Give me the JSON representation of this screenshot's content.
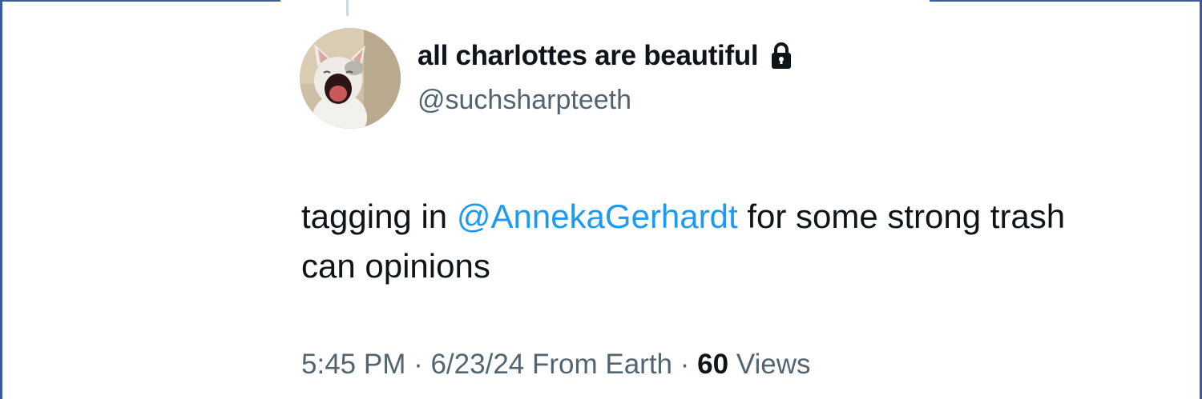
{
  "author": {
    "display_name": "all charlottes are beautiful",
    "handle": "@suchsharpteeth",
    "protected_icon": "lock-icon",
    "avatar_icon": "cat-avatar"
  },
  "tweet": {
    "text_before": "tagging in ",
    "mention": "@AnnekaGerhardt",
    "text_after": " for some strong trash can opinions"
  },
  "meta": {
    "time": "5:45 PM",
    "separator": " · ",
    "date": "6/23/24",
    "location": "From Earth",
    "views_count": "60",
    "views_label": "Views"
  },
  "colors": {
    "mention": "#1d9bf0",
    "secondary_text": "#536471",
    "primary_text": "#0f1419",
    "frame_border": "#3b5aa8"
  }
}
